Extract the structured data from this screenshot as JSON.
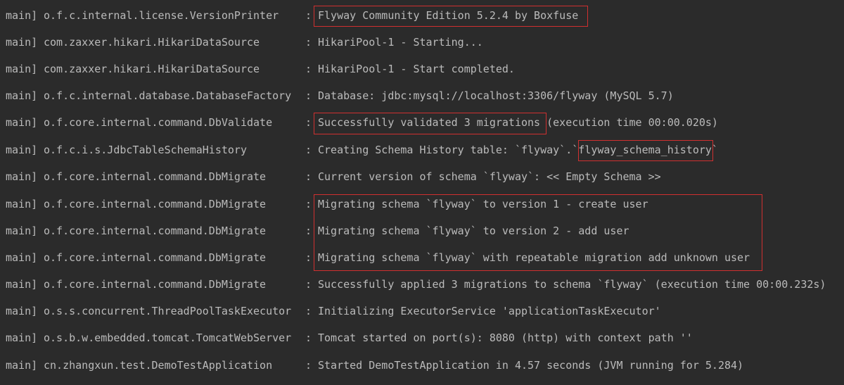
{
  "console": {
    "lines": [
      {
        "thread": "main]",
        "logger": "o.f.c.internal.license.VersionPrinter",
        "sep": ":",
        "message": "Flyway Community Edition 5.2.4 by Boxfuse"
      },
      {
        "thread": "main]",
        "logger": "com.zaxxer.hikari.HikariDataSource",
        "sep": ":",
        "message": "HikariPool-1 - Starting..."
      },
      {
        "thread": "main]",
        "logger": "com.zaxxer.hikari.HikariDataSource",
        "sep": ":",
        "message": "HikariPool-1 - Start completed."
      },
      {
        "thread": "main]",
        "logger": "o.f.c.internal.database.DatabaseFactory",
        "sep": ":",
        "message": "Database: jdbc:mysql://localhost:3306/flyway (MySQL 5.7)"
      },
      {
        "thread": "main]",
        "logger": "o.f.core.internal.command.DbValidate",
        "sep": ":",
        "message": "Successfully validated 3 migrations (execution time 00:00.020s)"
      },
      {
        "thread": "main]",
        "logger": "o.f.c.i.s.JdbcTableSchemaHistory",
        "sep": ":",
        "message": "Creating Schema History table: `flyway`.`flyway_schema_history`"
      },
      {
        "thread": "main]",
        "logger": "o.f.core.internal.command.DbMigrate",
        "sep": ":",
        "message": "Current version of schema `flyway`: << Empty Schema >>"
      },
      {
        "thread": "main]",
        "logger": "o.f.core.internal.command.DbMigrate",
        "sep": ":",
        "message": "Migrating schema `flyway` to version 1 - create user"
      },
      {
        "thread": "main]",
        "logger": "o.f.core.internal.command.DbMigrate",
        "sep": ":",
        "message": "Migrating schema `flyway` to version 2 - add user"
      },
      {
        "thread": "main]",
        "logger": "o.f.core.internal.command.DbMigrate",
        "sep": ":",
        "message": "Migrating schema `flyway` with repeatable migration add unknown user"
      },
      {
        "thread": "main]",
        "logger": "o.f.core.internal.command.DbMigrate",
        "sep": ":",
        "message": "Successfully applied 3 migrations to schema `flyway` (execution time 00:00.232s)"
      },
      {
        "thread": "main]",
        "logger": "o.s.s.concurrent.ThreadPoolTaskExecutor",
        "sep": ":",
        "message": "Initializing ExecutorService 'applicationTaskExecutor'"
      },
      {
        "thread": "main]",
        "logger": "o.s.b.w.embedded.tomcat.TomcatWebServer",
        "sep": ":",
        "message": "Tomcat started on port(s): 8080 (http) with context path ''"
      },
      {
        "thread": "main]",
        "logger": "cn.zhangxun.test.DemoTestApplication",
        "sep": ":",
        "message": "Started DemoTestApplication in 4.57 seconds (JVM running for 5.284)"
      }
    ]
  },
  "colors": {
    "background": "#2b2b2b",
    "text": "#bbbbbb",
    "highlight_border": "#d03030"
  }
}
